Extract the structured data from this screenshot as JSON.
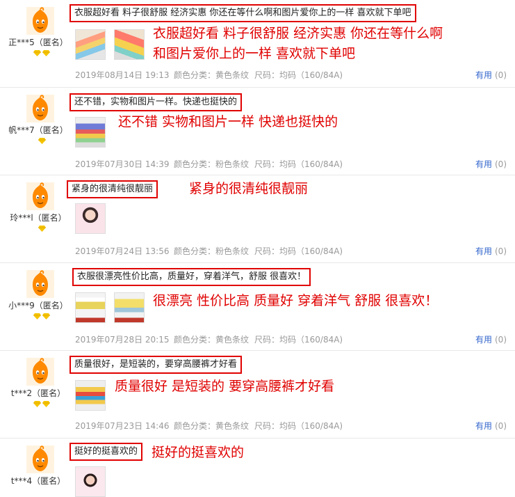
{
  "reviews": [
    {
      "user": "正***5（匿名）",
      "diamond_count": 2,
      "comment": "衣服超好看 料子很舒服 经济实惠 你还在等什么啊和图片爱你上的一样 喜欢就下单吧",
      "annotation_lines": [
        "衣服超好看 料子很舒服 经济实惠 你还在等什么啊",
        "和图片爱你上的一样 喜欢就下单吧"
      ],
      "photo_count": 2,
      "date": "2019年08月14日 19:13",
      "color": "颜色分类：黄色条纹",
      "size": "尺码：均码（160/84A)",
      "helpful_label": "有用",
      "helpful_count": "(0)"
    },
    {
      "user": "帆***7（匿名）",
      "diamond_count": 1,
      "comment": "还不错，实物和图片一样。快递也挺快的",
      "annotation_lines": [
        "还不错 实物和图片一样 快递也挺快的"
      ],
      "photo_count": 1,
      "date": "2019年07月30日 14:39",
      "color": "颜色分类：粉色条纹",
      "size": "尺码：均码（160/84A)",
      "helpful_label": "有用",
      "helpful_count": "(0)"
    },
    {
      "user": "玲***l（匿名）",
      "diamond_count": 1,
      "comment": "紧身的很清纯很靓丽",
      "annotation_lines": [
        "紧身的很清纯很靓丽"
      ],
      "photo_count": 1,
      "date": "2019年07月24日 13:56",
      "color": "颜色分类：粉色条纹",
      "size": "尺码：均码（160/84A)",
      "helpful_label": "有用",
      "helpful_count": "(0)"
    },
    {
      "user": "小***9（匿名）",
      "diamond_count": 2,
      "comment": "衣服很漂亮性价比高，质量好，穿着洋气，舒服 很喜欢！",
      "annotation_lines": [
        "很漂亮 性价比高 质量好 穿着洋气 舒服 很喜欢！"
      ],
      "photo_count": 2,
      "date": "2019年07月28日 20:15",
      "color": "颜色分类：黄色条纹",
      "size": "尺码：均码（160/84A)",
      "helpful_label": "有用",
      "helpful_count": "(0)"
    },
    {
      "user": "t***2（匿名）",
      "diamond_count": 2,
      "comment": "质量很好，是短装的，要穿高腰裤才好看",
      "annotation_lines": [
        "质量很好 是短装的 要穿高腰裤才好看"
      ],
      "photo_count": 1,
      "date": "2019年07月23日 14:46",
      "color": "颜色分类：黄色条纹",
      "size": "尺码：均码（160/84A)",
      "helpful_label": "有用",
      "helpful_count": "(0)"
    },
    {
      "user": "t***4（匿名）",
      "diamond_count": 0,
      "comment": "挺好的挺喜欢的",
      "annotation_lines": [
        "挺好的挺喜欢的"
      ],
      "photo_count": 1,
      "date": "",
      "color": "",
      "size": "",
      "helpful_label": "",
      "helpful_count": ""
    }
  ],
  "colors": {
    "highlight_red": "#e00000",
    "link_blue": "#3366cc",
    "meta_gray": "#999999",
    "avatar_orange": "#ff8a00",
    "diamond_yellow": "#f5c400"
  },
  "icons": {
    "avatar": "orange-mascot-avatar",
    "badge": "diamond-icon"
  }
}
